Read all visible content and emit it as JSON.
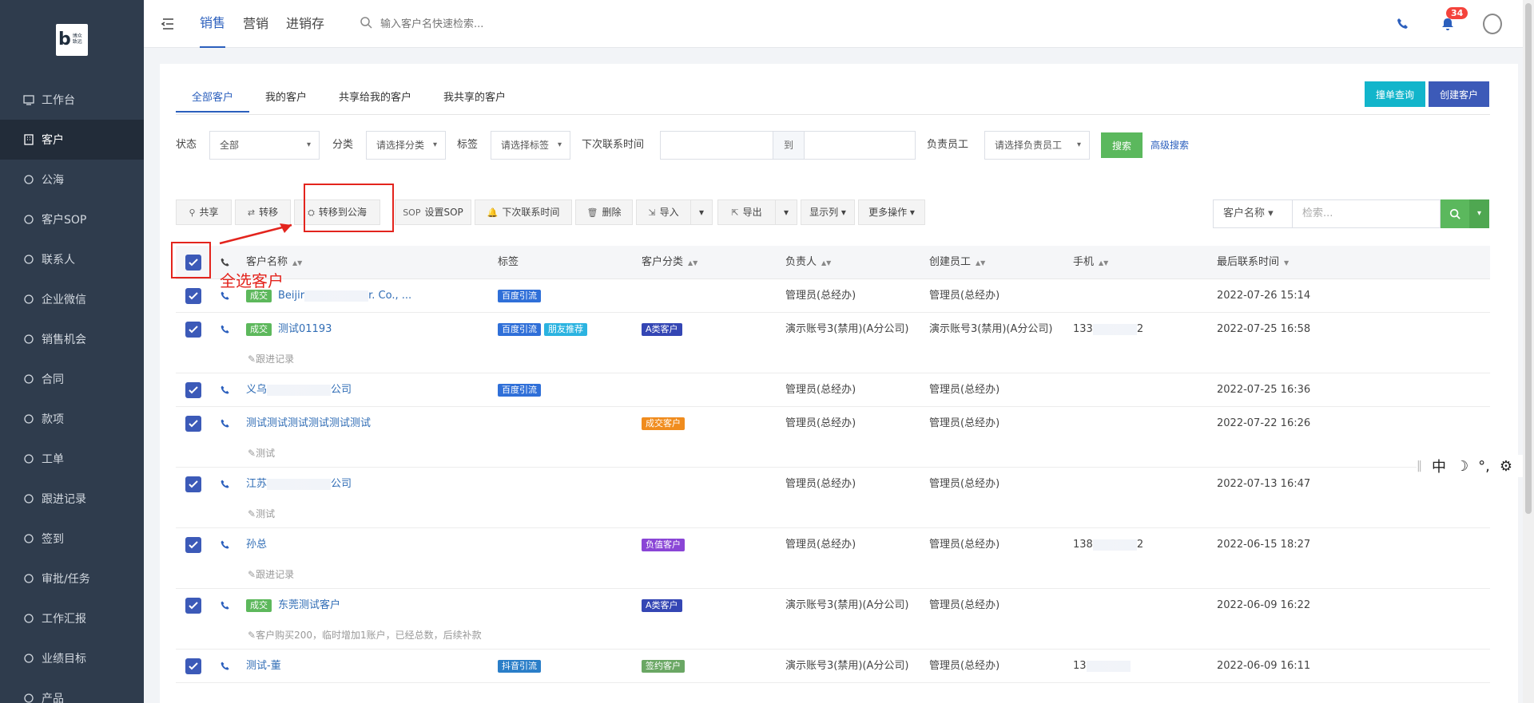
{
  "sidebar": {
    "logo": {
      "mark": "b",
      "text1": "博众",
      "text2": "致远"
    },
    "items": [
      {
        "label": "工作台",
        "icon": "monitor-icon"
      },
      {
        "label": "客户",
        "icon": "building-icon",
        "active": true
      },
      {
        "label": "公海",
        "icon": "bag-icon"
      },
      {
        "label": "客户SOP",
        "icon": "sop-icon"
      },
      {
        "label": "联系人",
        "icon": "contact-icon"
      },
      {
        "label": "企业微信",
        "icon": "wechat-icon"
      },
      {
        "label": "销售机会",
        "icon": "moneybag-icon"
      },
      {
        "label": "合同",
        "icon": "contract-icon"
      },
      {
        "label": "款项",
        "icon": "payment-icon"
      },
      {
        "label": "工单",
        "icon": "ticket-icon"
      },
      {
        "label": "跟进记录",
        "icon": "edit-icon"
      },
      {
        "label": "签到",
        "icon": "checkin-icon"
      },
      {
        "label": "审批/任务",
        "icon": "approval-icon"
      },
      {
        "label": "工作汇报",
        "icon": "report-icon"
      },
      {
        "label": "业绩目标",
        "icon": "target-icon"
      },
      {
        "label": "产品",
        "icon": "product-icon"
      }
    ]
  },
  "topbar": {
    "tabs": [
      "销售",
      "营销",
      "进销存"
    ],
    "search_placeholder": "输入客户名快速检索...",
    "notification_count": "34"
  },
  "card": {
    "subtabs": [
      "全部客户",
      "我的客户",
      "共享给我的客户",
      "我共享的客户"
    ],
    "btn_query": "撞单查询",
    "btn_create": "创建客户"
  },
  "filters": {
    "status_label": "状态",
    "status_value": "全部",
    "category_label": "分类",
    "category_placeholder": "请选择分类",
    "tag_label": "标签",
    "tag_placeholder": "请选择标签",
    "next_contact_label": "下次联系时间",
    "to": "到",
    "owner_label": "负责员工",
    "owner_placeholder": "请选择负责员工",
    "search": "搜索",
    "advanced": "高级搜索"
  },
  "toolbar": {
    "share": "共享",
    "transfer": "转移",
    "to_pool": "转移到公海",
    "set_sop": "设置SOP",
    "next_contact": "下次联系时间",
    "delete": "删除",
    "import": "导入",
    "export": "导出",
    "columns": "显示列",
    "more": "更多操作"
  },
  "search_group": {
    "field": "客户名称",
    "placeholder": "检索..."
  },
  "table": {
    "headers": {
      "name": "客户名称",
      "tags": "标签",
      "category": "客户分类",
      "owner": "负责人",
      "creator": "创建员工",
      "mobile": "手机",
      "last_contact": "最后联系时间"
    },
    "rows": [
      {
        "deal": "成交",
        "name_pre": "Beijir",
        "name_post": "r. Co., ...",
        "tags": [
          {
            "t": "百度引流",
            "c": "t-bd"
          }
        ],
        "category": null,
        "owner": "管理员(总经办)",
        "creator": "管理员(总经办)",
        "mobile": "",
        "time": "2022-07-26 15:14",
        "note": null
      },
      {
        "deal": "成交",
        "name_pre": "测试01193",
        "name_post": "",
        "tags": [
          {
            "t": "百度引流",
            "c": "t-bd"
          },
          {
            "t": "朋友推荐",
            "c": "t-py"
          }
        ],
        "category": {
          "t": "A类客户",
          "c": "t-a"
        },
        "owner": "演示账号3(禁用)(A分公司)",
        "creator": "演示账号3(禁用)(A分公司)",
        "mobile_pre": "133",
        "mobile_post": "2",
        "time": "2022-07-25 16:58",
        "note": "跟进记录"
      },
      {
        "deal": null,
        "name_pre": "义乌",
        "name_post": "公司",
        "tags": [
          {
            "t": "百度引流",
            "c": "t-bd"
          }
        ],
        "category": null,
        "owner": "管理员(总经办)",
        "creator": "管理员(总经办)",
        "mobile": "",
        "time": "2022-07-25 16:36",
        "note": null
      },
      {
        "deal": null,
        "name_pre": "测试测试测试测试测试测试",
        "name_post": "",
        "tags": [],
        "category": {
          "t": "成交客户",
          "c": "t-cj"
        },
        "owner": "管理员(总经办)",
        "creator": "管理员(总经办)",
        "mobile": "",
        "time": "2022-07-22 16:26",
        "note": "测试"
      },
      {
        "deal": null,
        "name_pre": "江苏",
        "name_post": "公司",
        "tags": [],
        "category": null,
        "owner": "管理员(总经办)",
        "creator": "管理员(总经办)",
        "mobile": "",
        "time": "2022-07-13 16:47",
        "note": "测试"
      },
      {
        "deal": null,
        "name_pre": "孙总",
        "name_post": "",
        "tags": [],
        "category": {
          "t": "负值客户",
          "c": "t-fz"
        },
        "owner": "管理员(总经办)",
        "creator": "管理员(总经办)",
        "mobile_pre": "138",
        "mobile_post": "2",
        "time": "2022-06-15 18:27",
        "note": "跟进记录"
      },
      {
        "deal": "成交",
        "name_pre": "东莞测试客户",
        "name_post": "",
        "tags": [],
        "category": {
          "t": "A类客户",
          "c": "t-a"
        },
        "owner": "演示账号3(禁用)(A分公司)",
        "creator": "管理员(总经办)",
        "mobile": "",
        "time": "2022-06-09 16:22",
        "note": "客户购买200，临时增加1账户，已经总数，后续补款"
      },
      {
        "deal": null,
        "name_pre": "测试-董",
        "name_post": "",
        "tags": [
          {
            "t": "抖音引流",
            "c": "t-dy"
          }
        ],
        "category": {
          "t": "签约客户",
          "c": "t-qy"
        },
        "owner": "演示账号3(禁用)(A分公司)",
        "creator": "管理员(总经办)",
        "mobile_pre": "13",
        "mobile_post": "",
        "time": "2022-06-09 16:11",
        "note": null
      }
    ]
  },
  "annotation": {
    "select_all": "全选客户"
  },
  "ime": [
    "中",
    "☽",
    "°,",
    "⚙"
  ]
}
